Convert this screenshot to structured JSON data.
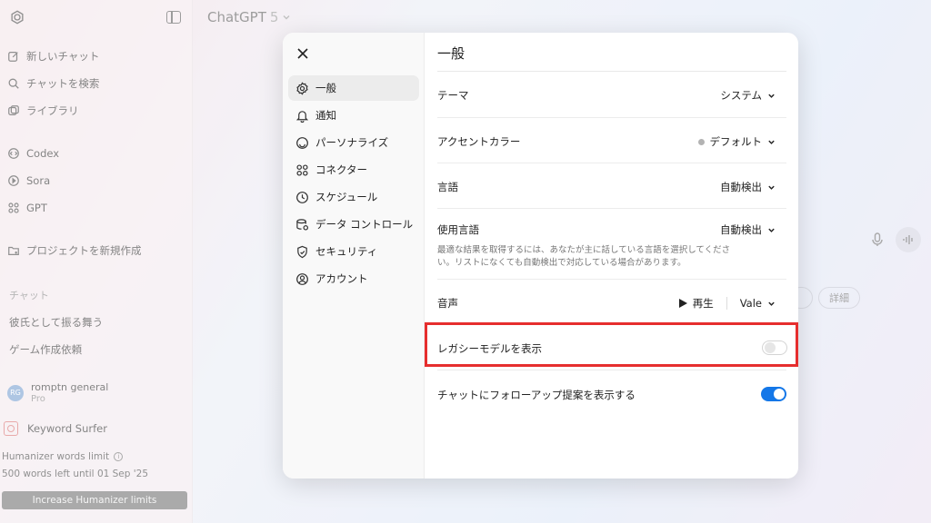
{
  "sidebar": {
    "items": [
      {
        "label": "新しいチャット",
        "icon": "edit-icon"
      },
      {
        "label": "チャットを検索",
        "icon": "search-icon"
      },
      {
        "label": "ライブラリ",
        "icon": "library-icon"
      },
      {
        "label": "Codex",
        "icon": "codex-icon"
      },
      {
        "label": "Sora",
        "icon": "sora-icon"
      },
      {
        "label": "GPT",
        "icon": "grid-icon"
      },
      {
        "label": "プロジェクトを新規作成",
        "icon": "folder-plus-icon"
      }
    ],
    "section_label": "チャット",
    "chats": [
      "彼氏として振る舞う",
      "ゲーム作成依頼"
    ],
    "user": {
      "initials": "RG",
      "name": "romptn general",
      "plan": "Pro"
    },
    "extension": {
      "name": "Keyword Surfer"
    },
    "humanizer": {
      "title": "Humanizer words limit",
      "remaining": "500 words left until 01 Sep '25",
      "button": "Increase Humanizer limits"
    }
  },
  "header": {
    "model": "ChatGPT",
    "version": "5"
  },
  "background": {
    "pill_label": "詳細"
  },
  "settings": {
    "nav": [
      {
        "label": "一般",
        "icon": "gear-icon",
        "active": true
      },
      {
        "label": "通知",
        "icon": "bell-icon"
      },
      {
        "label": "パーソナライズ",
        "icon": "personalize-icon"
      },
      {
        "label": "コネクター",
        "icon": "connector-icon"
      },
      {
        "label": "スケジュール",
        "icon": "clock-icon"
      },
      {
        "label": "データ コントロール",
        "icon": "database-icon"
      },
      {
        "label": "セキュリティ",
        "icon": "shield-icon"
      },
      {
        "label": "アカウント",
        "icon": "user-circle-icon"
      }
    ],
    "title": "一般",
    "theme": {
      "label": "テーマ",
      "value": "システム"
    },
    "accent": {
      "label": "アクセントカラー",
      "value": "デフォルト",
      "dot_color": "#b3b3b3"
    },
    "language": {
      "label": "言語",
      "value": "自動検出"
    },
    "spoken_language": {
      "label": "使用言語",
      "value": "自動検出",
      "description": "最適な結果を取得するには、あなたが主に話している言語を選択してください。リストになくても自動検出で対応している場合があります。"
    },
    "voice": {
      "label": "音声",
      "play_label": "再生",
      "value": "Vale"
    },
    "legacy_models": {
      "label": "レガシーモデルを表示",
      "enabled": false
    },
    "followup": {
      "label": "チャットにフォローアップ提案を表示する",
      "enabled": true
    }
  },
  "colors": {
    "toggle_on": "#1477e8",
    "highlight": "#e62e2e"
  }
}
